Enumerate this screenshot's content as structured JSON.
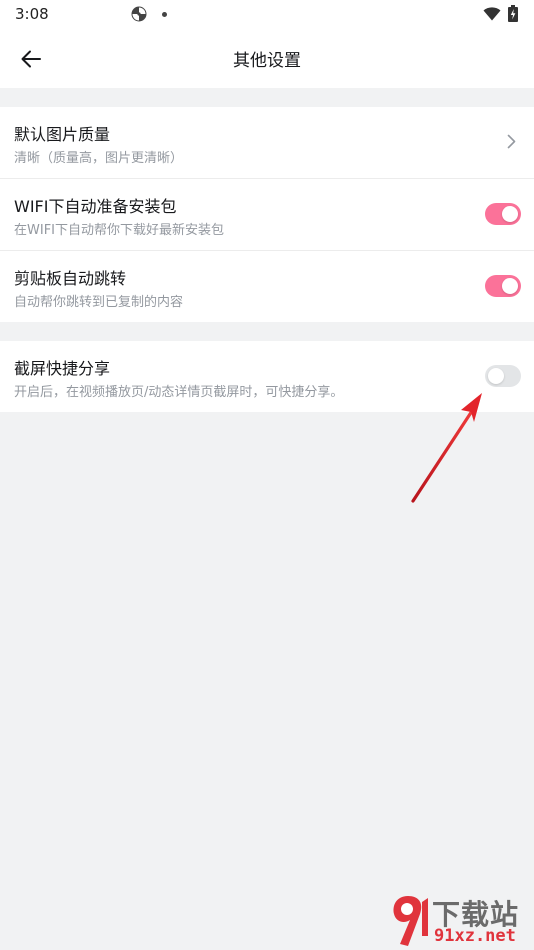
{
  "status_bar": {
    "time": "3:08",
    "app_icon": "pinwheel-icon",
    "wifi_icon": "wifi-icon",
    "battery_icon": "battery-charging-icon"
  },
  "header": {
    "title": "其他设置",
    "back_icon": "arrow-left-icon"
  },
  "groups": [
    {
      "items": [
        {
          "title": "默认图片质量",
          "subtitle": "清晰（质量高，图片更清晰）",
          "control": "chevron"
        },
        {
          "title": "WIFI下自动准备安装包",
          "subtitle": "在WIFI下自动帮你下载好最新安装包",
          "control": "toggle",
          "on": true
        },
        {
          "title": "剪贴板自动跳转",
          "subtitle": "自动帮你跳转到已复制的内容",
          "control": "toggle",
          "on": true
        }
      ]
    },
    {
      "items": [
        {
          "title": "截屏快捷分享",
          "subtitle": "开启后，在视频播放页/动态详情页截屏时，可快捷分享。",
          "control": "toggle",
          "on": false
        }
      ]
    }
  ],
  "colors": {
    "accent_pink": "#fb7299",
    "annotation_arrow": "#e0343c",
    "background": "#f1f2f3"
  },
  "watermark": {
    "name": "下载站",
    "domain": "91xz.net"
  }
}
